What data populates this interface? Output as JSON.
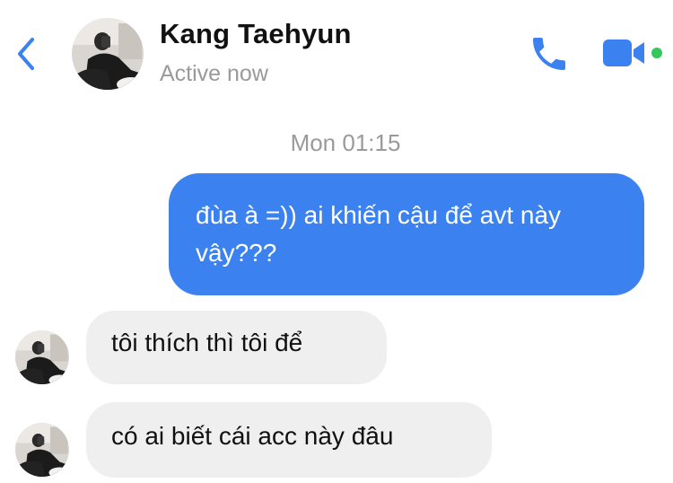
{
  "header": {
    "contact_name": "Kang Taehyun",
    "status": "Active now",
    "accent_color": "#3b82f0",
    "active_dot_color": "#34c759",
    "icons": [
      "chevron-left-icon",
      "phone-icon",
      "video-camera-icon"
    ]
  },
  "chat": {
    "timestamp": "Mon 01:15",
    "messages": [
      {
        "direction": "outgoing",
        "text": "đùa à =)) ai khiến cậu để avt này vậy???"
      },
      {
        "direction": "incoming",
        "text": "tôi thích thì tôi để"
      },
      {
        "direction": "incoming",
        "text": "có ai biết cái acc này đâu"
      }
    ]
  }
}
